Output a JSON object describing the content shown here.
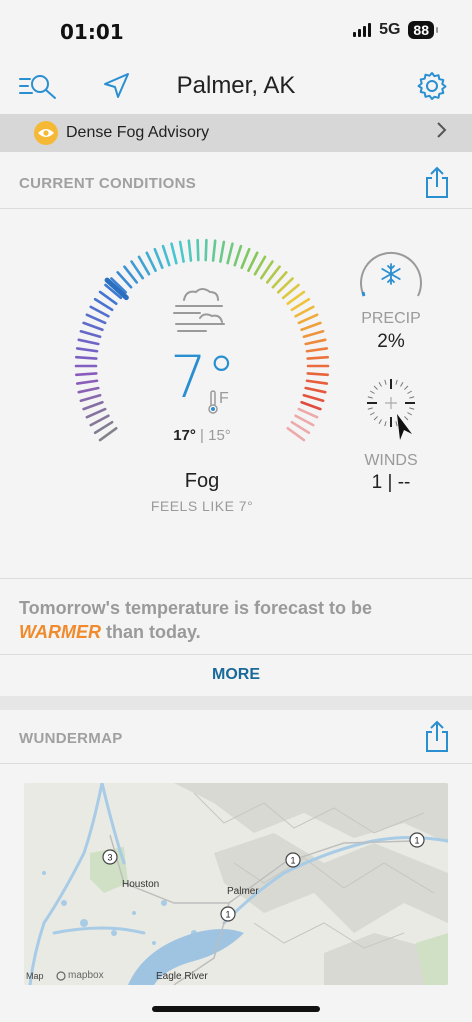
{
  "status": {
    "time": "01:01",
    "network": "5G",
    "battery": "88"
  },
  "header": {
    "city": "Palmer, AK"
  },
  "advisory": {
    "text": "Dense Fog Advisory"
  },
  "current": {
    "section_title": "CURRENT CONDITIONS",
    "temperature": "7°",
    "unit": "F",
    "high": "17°",
    "separator": "|",
    "low": "15°",
    "condition": "Fog",
    "feels_like": "FEELS LIKE 7°",
    "precip_label": "PRECIP",
    "precip_value": "2%",
    "winds_label": "WINDS",
    "winds_value": "1 | --"
  },
  "forecast_note": {
    "before": "Tomorrow's temperature is forecast to be ",
    "highlight": "WARMER",
    "after": " than today.",
    "highlight_color": "#f08a2a"
  },
  "more_label": "MORE",
  "wundermap": {
    "section_title": "WUNDERMAP",
    "labels": {
      "houston": "Houston",
      "palmer": "Palmer",
      "eagle_river": "Eagle River",
      "map_attr": "Map",
      "mapbox": "mapbox"
    },
    "route_markers": [
      "3",
      "1",
      "1",
      "1"
    ]
  },
  "colors": {
    "accent_blue": "#2a8fd1",
    "advisory_yellow": "#f5b935",
    "link_blue": "#1a6a99"
  }
}
